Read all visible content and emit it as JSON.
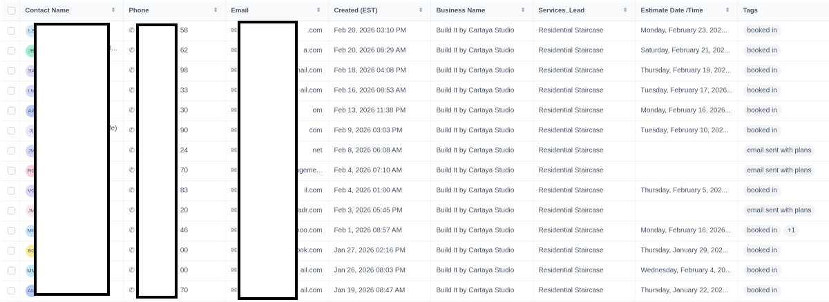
{
  "headers": {
    "contact": "Contact Name",
    "phone": "Phone",
    "email": "Email",
    "created": "Created (EST)",
    "business": "Business Name",
    "services": "Services_Lead",
    "estimate": "Estimate Date /Time",
    "tags": "Tags"
  },
  "rows": [
    {
      "initials": "LS",
      "color": "#cfe8f7",
      "name_tail": "",
      "phone_tail": "58",
      "email_tail": ".com",
      "created": "Feb 20, 2026 03:10 PM",
      "business": "Build It by Cartaya Studio",
      "services": "Residential Staircase",
      "estimate": "Monday, February 23, 202...",
      "tags": [
        "booked in"
      ]
    },
    {
      "initials": "JB",
      "color": "#a7ecd2",
      "name_tail": "al...",
      "phone_tail": "62",
      "email_tail": "a.com",
      "created": "Feb 20, 2026 08:29 AM",
      "business": "Build It by Cartaya Studio",
      "services": "Residential Staircase",
      "estimate": "Saturday, February 21, 202...",
      "tags": [
        "booked in"
      ]
    },
    {
      "initials": "SA",
      "color": "#e3dcf8",
      "name_tail": "",
      "phone_tail": "98",
      "email_tail": "gmail.com",
      "created": "Feb 18, 2026 04:08 PM",
      "business": "Build It by Cartaya Studio",
      "services": "Residential Staircase",
      "estimate": "Thursday, February 19, 202...",
      "tags": [
        "booked in"
      ]
    },
    {
      "initials": "LM",
      "color": "#d3dbf7",
      "name_tail": "",
      "phone_tail": "33",
      "email_tail": "ail.com",
      "created": "Feb 16, 2026 08:53 AM",
      "business": "Build It by Cartaya Studio",
      "services": "Residential Staircase",
      "estimate": "Tuesday, February 17, 2026...",
      "tags": [
        "booked in"
      ]
    },
    {
      "initials": "AA",
      "color": "#b9cdf6",
      "name_tail": "",
      "phone_tail": "30",
      "email_tail": "om",
      "created": "Feb 13, 2026 11:38 PM",
      "business": "Build It by Cartaya Studio",
      "services": "Residential Staircase",
      "estimate": "Monday, February 16, 2026...",
      "tags": [
        "booked in"
      ]
    },
    {
      "initials": "J(",
      "color": "#ebe4fa",
      "name_tail": "ife)",
      "phone_tail": "90",
      "email_tail": "com",
      "created": "Feb 9, 2026 03:03 PM",
      "business": "Build It by Cartaya Studio",
      "services": "Residential Staircase",
      "estimate": "Tuesday, February 10, 202...",
      "tags": [
        "booked in"
      ]
    },
    {
      "initials": "JM",
      "color": "#d3d8f7",
      "name_tail": "",
      "phone_tail": "24",
      "email_tail": "net",
      "created": "Feb 8, 2026 06:08 AM",
      "business": "Build It by Cartaya Studio",
      "services": "Residential Staircase",
      "estimate": "",
      "tags": [
        "email sent with plans"
      ]
    },
    {
      "initials": "RG",
      "color": "#f9d0d8",
      "name_tail": "",
      "phone_tail": "70",
      "email_tail": "nageme...",
      "created": "Feb 4, 2026 07:10 AM",
      "business": "Build It by Cartaya Studio",
      "services": "Residential Staircase",
      "estimate": "",
      "tags": [
        "email sent with plans"
      ]
    },
    {
      "initials": "VG",
      "color": "#ddd6f8",
      "name_tail": "",
      "phone_tail": "83",
      "email_tail": "il.com",
      "created": "Feb 4, 2026 01:00 AM",
      "business": "Build It by Cartaya Studio",
      "services": "Residential Staircase",
      "estimate": "Thursday, February 5, 202...",
      "tags": [
        "booked in"
      ]
    },
    {
      "initials": "JM",
      "color": "#fbe6ef",
      "name_tail": "",
      "phone_tail": "20",
      "email_tail": "tadr.com",
      "created": "Feb 3, 2026 05:45 PM",
      "business": "Build It by Cartaya Studio",
      "services": "Residential Staircase",
      "estimate": "",
      "tags": [
        "email sent with plans"
      ]
    },
    {
      "initials": "MR",
      "color": "#c6e4fa",
      "name_tail": "",
      "phone_tail": "46",
      "email_tail": "hoo.com",
      "created": "Feb 1, 2026 08:57 AM",
      "business": "Build It by Cartaya Studio",
      "services": "Residential Staircase",
      "estimate": "Monday, February 16, 2026...",
      "tags": [
        "booked in",
        "+1"
      ]
    },
    {
      "initials": "BG",
      "color": "#faeb9c",
      "name_tail": "",
      "phone_tail": "00",
      "email_tail": "tlook.com",
      "created": "Jan 27, 2026 02:16 PM",
      "business": "Build It by Cartaya Studio",
      "services": "Residential Staircase",
      "estimate": "Thursday, January 29, 202...",
      "tags": [
        "booked in"
      ]
    },
    {
      "initials": "MM",
      "color": "#c7e8f7",
      "name_tail": "",
      "phone_tail": "00",
      "email_tail": "ail.com",
      "created": "Jan 26, 2026 08:03 PM",
      "business": "Build It by Cartaya Studio",
      "services": "Residential Staircase",
      "estimate": "Wednesday, February 4, 20...",
      "tags": [
        "booked in"
      ]
    },
    {
      "initials": "AM",
      "color": "#b6c9f5",
      "name_tail": "",
      "phone_tail": "70",
      "email_tail": "ail.com",
      "created": "Jan 19, 2026 08:47 AM",
      "business": "Build It by Cartaya Studio",
      "services": "Residential Staircase",
      "estimate": "Thursday, January 22, 202...",
      "tags": [
        "booked in"
      ]
    }
  ]
}
